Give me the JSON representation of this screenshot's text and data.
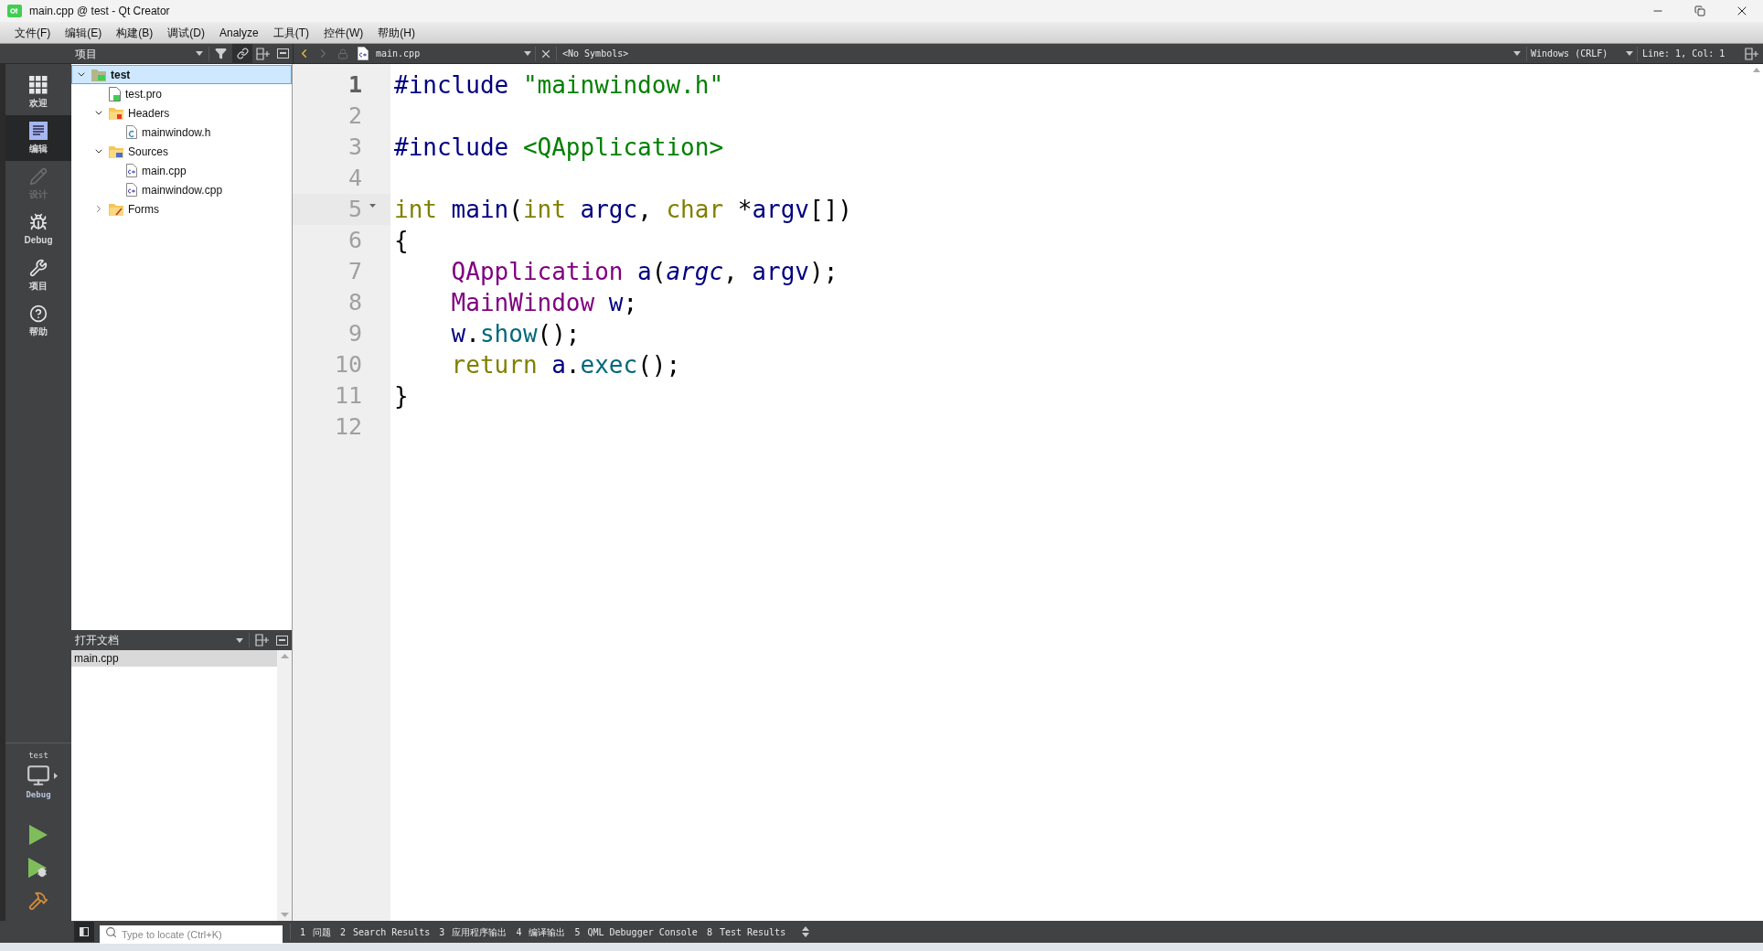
{
  "window": {
    "title": "main.cpp @ test - Qt Creator"
  },
  "menu": [
    "文件(F)",
    "编辑(E)",
    "构建(B)",
    "调试(D)",
    "Analyze",
    "工具(T)",
    "控件(W)",
    "帮助(H)"
  ],
  "modes": [
    {
      "label": "欢迎",
      "kind": "welcome",
      "selected": false,
      "disabled": false
    },
    {
      "label": "编辑",
      "kind": "edit",
      "selected": true,
      "disabled": false
    },
    {
      "label": "设计",
      "kind": "design",
      "selected": false,
      "disabled": true
    },
    {
      "label": "Debug",
      "kind": "debug",
      "selected": false,
      "disabled": false
    },
    {
      "label": "项目",
      "kind": "projects",
      "selected": false,
      "disabled": false
    },
    {
      "label": "帮助",
      "kind": "help",
      "selected": false,
      "disabled": false
    }
  ],
  "kit": {
    "project": "test",
    "build": "Debug"
  },
  "run_buttons": [
    {
      "kind": "run"
    },
    {
      "kind": "debug_run"
    },
    {
      "kind": "build"
    }
  ],
  "projects_pane": {
    "title": "项目",
    "link_synced": true,
    "tree": [
      {
        "name": "test",
        "kind": "project",
        "expanded": true,
        "selected": true,
        "children": [
          {
            "name": "test.pro",
            "kind": "pro",
            "selected": false
          },
          {
            "name": "Headers",
            "kind": "folder_h",
            "expanded": true,
            "selected": false,
            "children": [
              {
                "name": "mainwindow.h",
                "kind": "header",
                "selected": false
              }
            ]
          },
          {
            "name": "Sources",
            "kind": "folder_cpp",
            "expanded": true,
            "selected": false,
            "children": [
              {
                "name": "main.cpp",
                "kind": "cpp",
                "selected": false
              },
              {
                "name": "mainwindow.cpp",
                "kind": "cpp",
                "selected": false
              }
            ]
          },
          {
            "name": "Forms",
            "kind": "folder_forms",
            "expanded": false,
            "selected": false
          }
        ]
      }
    ]
  },
  "open_documents": {
    "title": "打开文档",
    "items": [
      {
        "name": "main.cpp",
        "selected": true
      }
    ]
  },
  "editor": {
    "file": "main.cpp",
    "symbols": "<No Symbols>",
    "line_ending": "Windows (CRLF)",
    "position": "Line: 1, Col: 1",
    "lines": [
      {
        "number": "1",
        "current": true,
        "foldable": false,
        "tokens": [
          {
            "text": "#include",
            "kind": "preproc"
          },
          {
            "text": " \"mainwindow.h\"",
            "kind": "string"
          }
        ]
      },
      {
        "number": "2",
        "current": false,
        "foldable": false
      },
      {
        "number": "3",
        "current": false,
        "foldable": false,
        "tokens": [
          {
            "text": "#include",
            "kind": "preproc"
          },
          {
            "text": " <QApplication>",
            "kind": "string"
          }
        ]
      },
      {
        "number": "4",
        "current": false,
        "foldable": false
      },
      {
        "number": "5",
        "current": false,
        "foldable": true,
        "tokens": [
          {
            "text": "int",
            "kind": "keyword"
          },
          {
            "text": " main",
            "kind": "ident"
          },
          {
            "text": "(",
            "kind": "plain"
          },
          {
            "text": "int",
            "kind": "keyword"
          },
          {
            "text": " argc",
            "kind": "ident"
          },
          {
            "text": ", ",
            "kind": "plain"
          },
          {
            "text": "char",
            "kind": "keyword"
          },
          {
            "text": " *",
            "kind": "plain"
          },
          {
            "text": "argv",
            "kind": "ident"
          },
          {
            "text": "[])",
            "kind": "plain"
          }
        ]
      },
      {
        "number": "6",
        "current": false,
        "foldable": false,
        "tokens": [
          {
            "text": "{",
            "kind": "plain"
          }
        ]
      },
      {
        "number": "7",
        "current": false,
        "foldable": false,
        "tokens": [
          {
            "text": "    QApplication",
            "kind": "type"
          },
          {
            "text": " a",
            "kind": "ident"
          },
          {
            "text": "(",
            "kind": "plain"
          },
          {
            "text": "argc",
            "kind": "param"
          },
          {
            "text": ", ",
            "kind": "plain"
          },
          {
            "text": "argv",
            "kind": "ident"
          },
          {
            "text": ");",
            "kind": "plain"
          }
        ]
      },
      {
        "number": "8",
        "current": false,
        "foldable": false,
        "tokens": [
          {
            "text": "    MainWindow",
            "kind": "type"
          },
          {
            "text": " w",
            "kind": "ident"
          },
          {
            "text": ";",
            "kind": "plain"
          }
        ]
      },
      {
        "number": "9",
        "current": false,
        "foldable": false,
        "tokens": [
          {
            "text": "    w",
            "kind": "ident"
          },
          {
            "text": ".",
            "kind": "plain"
          },
          {
            "text": "show",
            "kind": "func"
          },
          {
            "text": "();",
            "kind": "plain"
          }
        ]
      },
      {
        "number": "10",
        "current": false,
        "foldable": false,
        "tokens": [
          {
            "text": "    return",
            "kind": "keyword"
          },
          {
            "text": " a",
            "kind": "ident"
          },
          {
            "text": ".",
            "kind": "plain"
          },
          {
            "text": "exec",
            "kind": "func"
          },
          {
            "text": "();",
            "kind": "plain"
          }
        ]
      },
      {
        "number": "11",
        "current": false,
        "foldable": false,
        "tokens": [
          {
            "text": "}",
            "kind": "plain"
          }
        ]
      },
      {
        "number": "12",
        "current": false,
        "foldable": false
      }
    ]
  },
  "status_bar": {
    "locate_placeholder": "Type to locate (Ctrl+K)",
    "output_tabs": [
      {
        "number": "1",
        "label": "问题"
      },
      {
        "number": "2",
        "label": "Search Results"
      },
      {
        "number": "3",
        "label": "应用程序输出"
      },
      {
        "number": "4",
        "label": "编译输出"
      },
      {
        "number": "5",
        "label": "QML Debugger Console"
      },
      {
        "number": "8",
        "label": "Test Results"
      }
    ]
  }
}
